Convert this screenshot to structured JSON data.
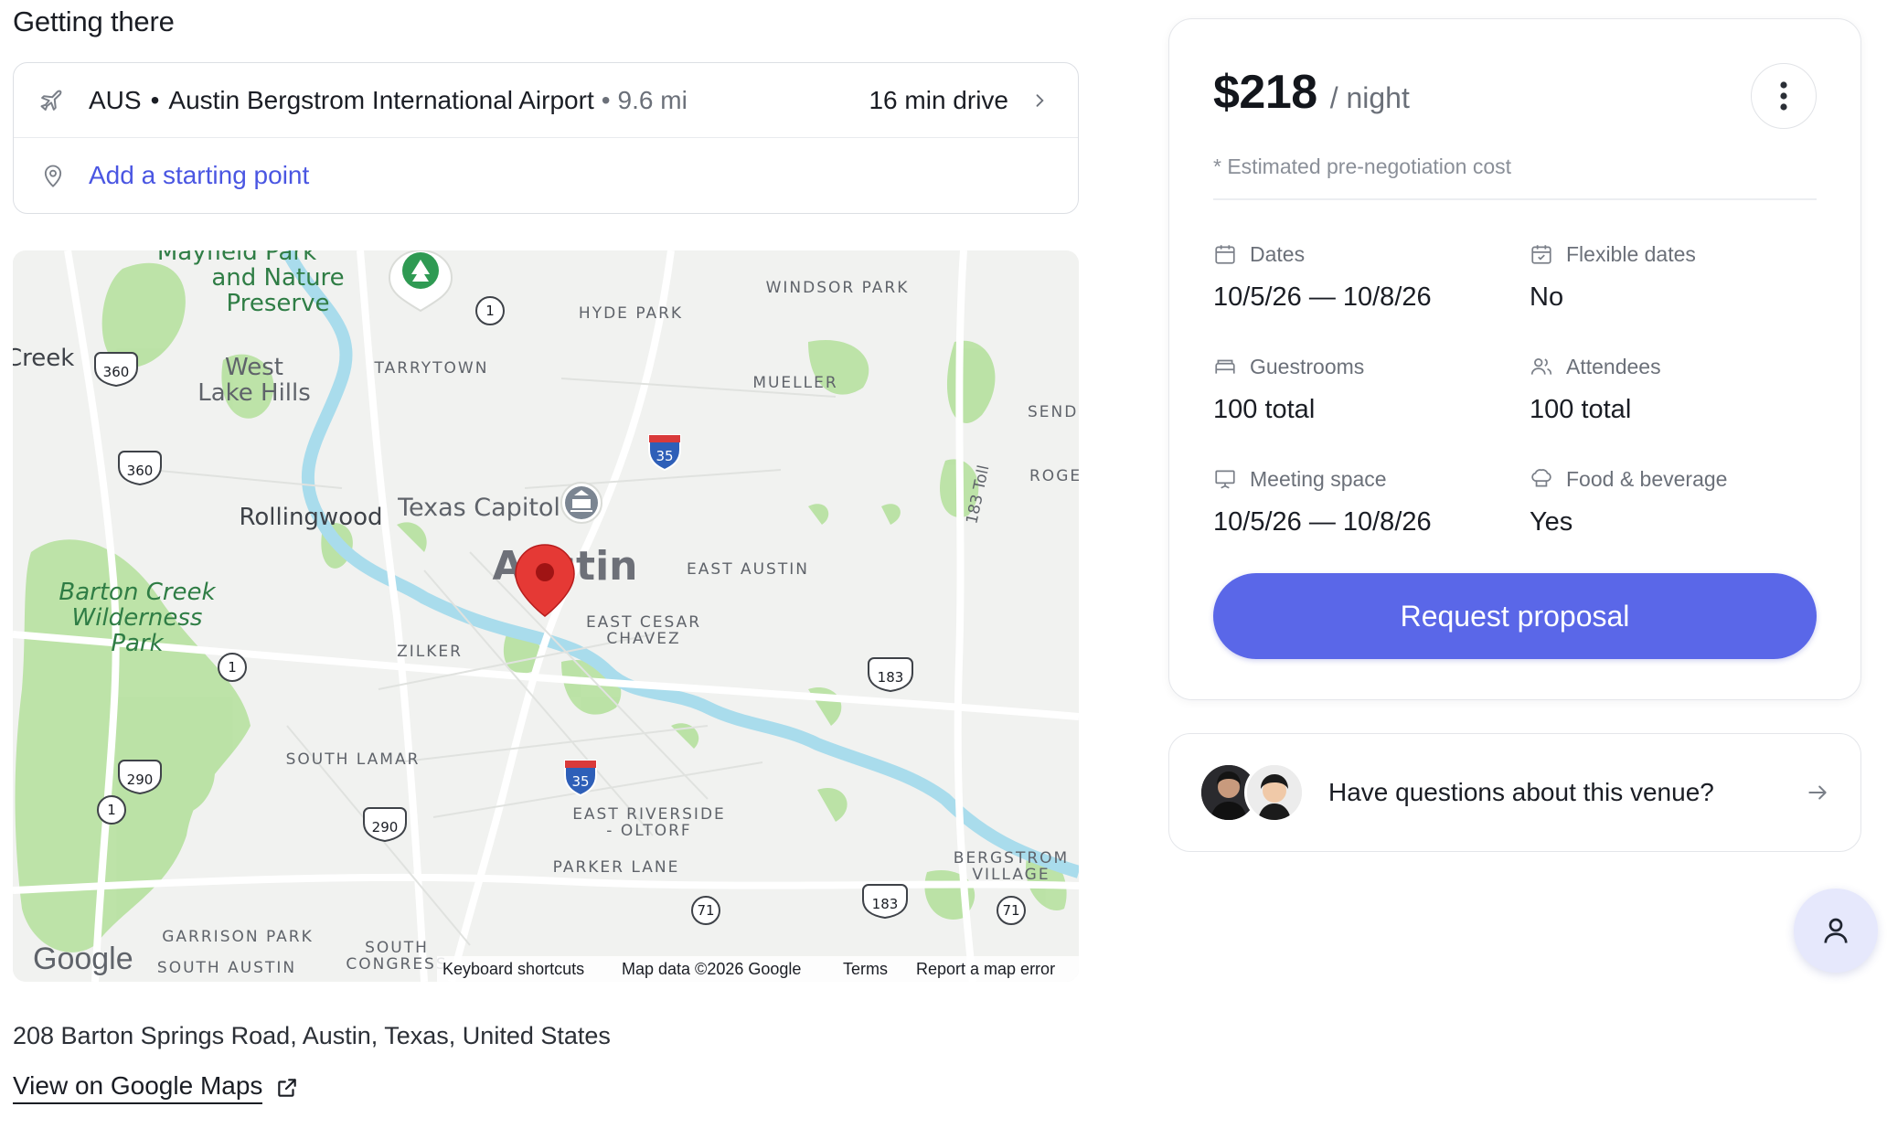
{
  "section_title": "Getting there",
  "directions": {
    "airport_code": "AUS",
    "airport_sep": "•",
    "airport_name": "Austin Bergstrom International Airport",
    "distance": "9.6 mi",
    "drive_time": "16 min drive",
    "add_start": "Add a starting point"
  },
  "map": {
    "labels": {
      "mayfield": [
        "Mayfield Park",
        "and Nature",
        "Preserve"
      ],
      "creek": "Creek",
      "west_lake": [
        "West",
        "Lake Hills"
      ],
      "tarrytown": "TARRYTOWN",
      "hyde_park": "HYDE PARK",
      "windsor_park": "WINDSOR PARK",
      "mueller": "MUELLER",
      "sender": "SENDEF",
      "rollingwood": "Rollingwood",
      "texas_capitol": "Texas Capitol",
      "austin": "Austin",
      "east_austin": "EAST AUSTIN",
      "roger": "ROGE",
      "toll_183": "183 Toll",
      "barton_creek": [
        "Barton Creek",
        "Wilderness",
        "Park"
      ],
      "zilker": "ZILKER",
      "east_cesar": [
        "EAST CESAR",
        "CHAVEZ"
      ],
      "south_lamar": "SOUTH LAMAR",
      "east_riverside": [
        "EAST RIVERSIDE",
        "- OLTORF"
      ],
      "parker_lane": "PARKER LANE",
      "bergstrom_village": [
        "BERGSTROM",
        "VILLAGE"
      ],
      "garrison_park": "GARRISON PARK",
      "south_austin": "SOUTH AUSTIN",
      "south_congress": [
        "SOUTH",
        "CONGRESS"
      ]
    },
    "shields": {
      "r1a": "1",
      "r360a": "360",
      "r360b": "360",
      "r1b": "1",
      "r290a": "290",
      "r1c": "1",
      "r290b": "290",
      "i35a": "35",
      "i35b": "35",
      "r183a": "183",
      "r183b": "183",
      "r71a": "71",
      "r71b": "71"
    },
    "footer": {
      "google": "Google",
      "keyboard": "Keyboard shortcuts",
      "map_data": "Map data ©2026 Google",
      "terms": "Terms",
      "report": "Report a map error"
    }
  },
  "address": "208 Barton Springs Road, Austin, Texas, United States",
  "view_on_maps": "View on Google Maps",
  "pricing": {
    "amount": "$218",
    "unit": "/ night",
    "estimate_note": "* Estimated pre-negotiation cost",
    "details": [
      {
        "label": "Dates",
        "value": "10/5/26 — 10/8/26",
        "icon": "calendar-icon"
      },
      {
        "label": "Flexible dates",
        "value": "No",
        "icon": "calendar-check-icon"
      },
      {
        "label": "Guestrooms",
        "value": "100 total",
        "icon": "bed-icon"
      },
      {
        "label": "Attendees",
        "value": "100 total",
        "icon": "people-icon"
      },
      {
        "label": "Meeting space",
        "value": "10/5/26 — 10/8/26",
        "icon": "presentation-icon"
      },
      {
        "label": "Food & beverage",
        "value": "Yes",
        "icon": "chef-hat-icon"
      }
    ],
    "request_button": "Request proposal"
  },
  "questions": {
    "text": "Have questions about this venue?"
  },
  "colors": {
    "accent": "#5a67e8",
    "link": "#4a56e2",
    "fab_bg": "#e6e8fc",
    "marker": "#e53935"
  }
}
